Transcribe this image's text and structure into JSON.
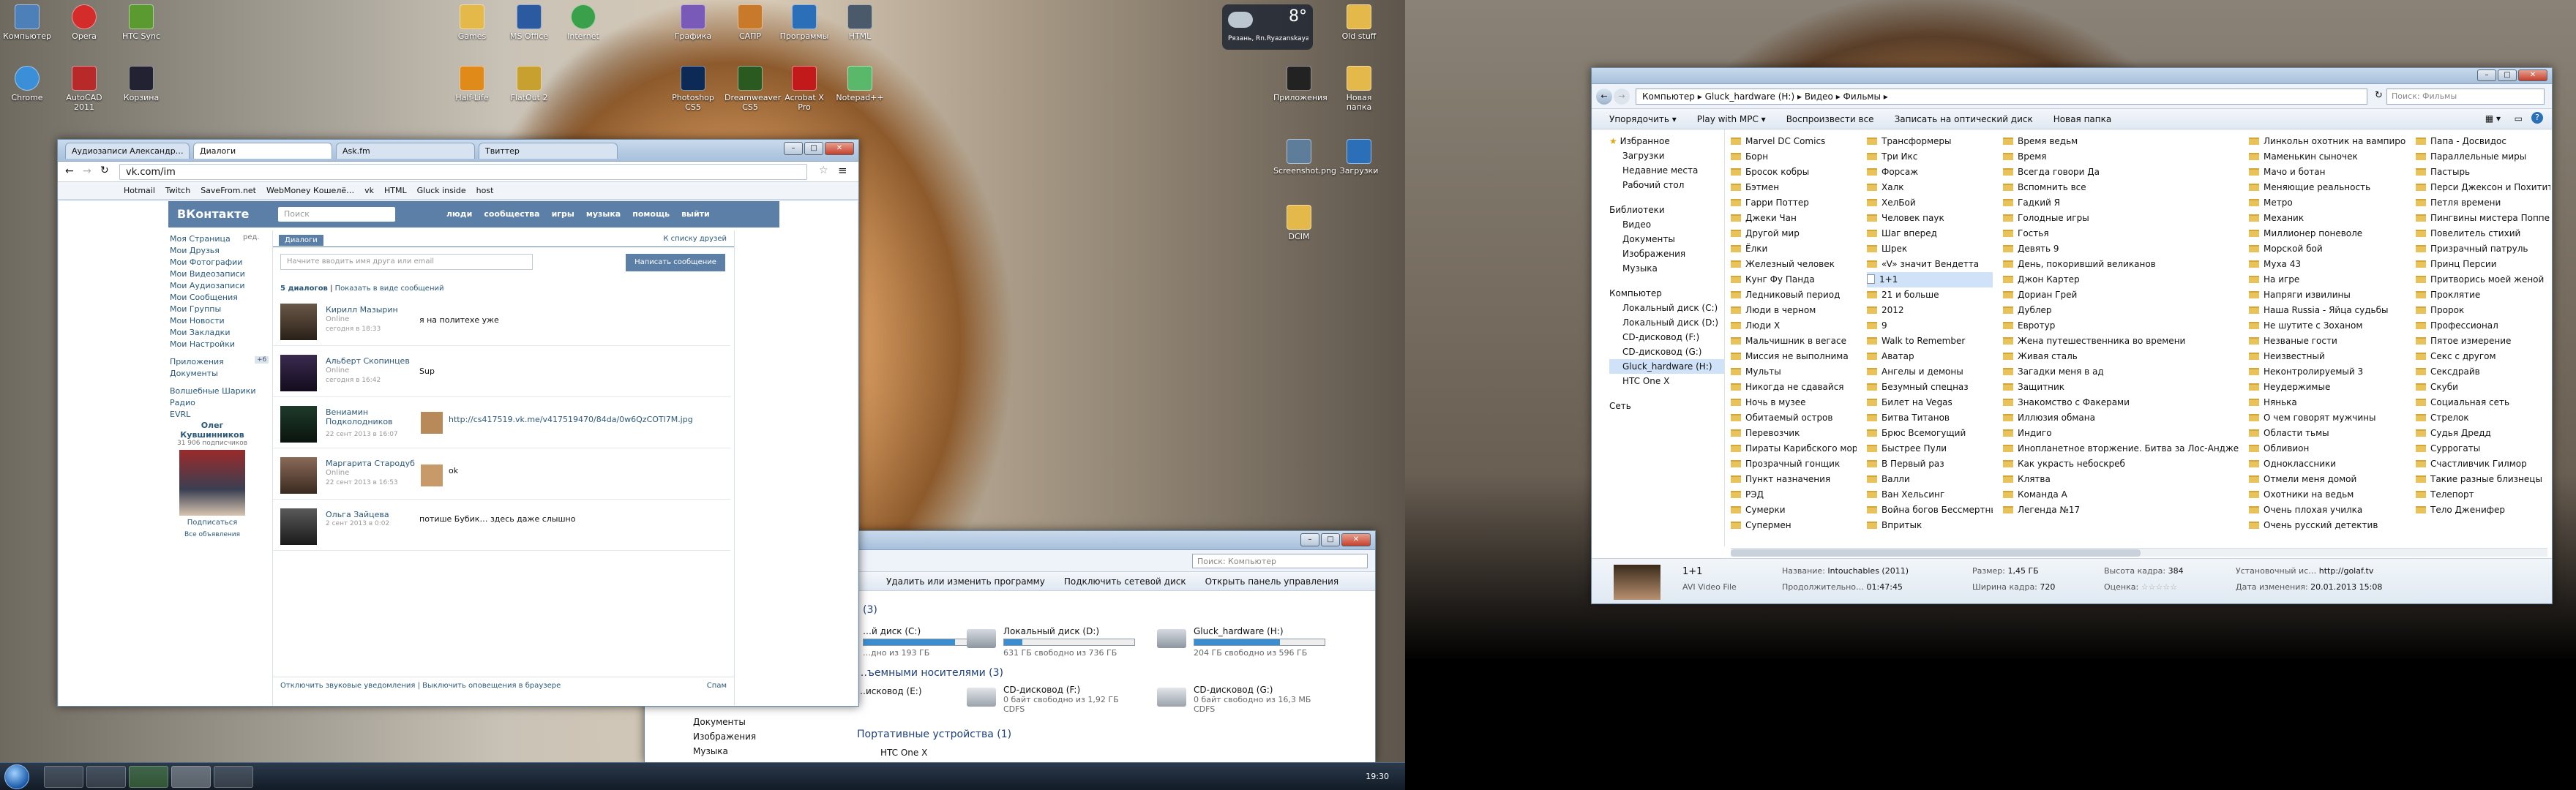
{
  "desktop_icons": {
    "computer": "Компьютер",
    "opera": "Opera",
    "htcsync": "HTC Sync",
    "games": "Games",
    "msoffice": "MS Office",
    "internet": "Internet",
    "grafika": "Графика",
    "sapr": "САПР",
    "programs": "Программы",
    "html": "HTML",
    "chrome": "Chrome",
    "recycle": "Корзина",
    "acad": "AutoCAD 2011",
    "half": "Half-Life",
    "flatout": "FlatOut 2",
    "ps": "Photoshop CS5",
    "dreamweaver": "Dreamweaver CS5",
    "acrobat": "Acrobat X Pro",
    "notepad": "Notepad++",
    "clock_city": "Рязань, Rn.Ryazanskaya",
    "temp": "8°",
    "screenshot": "Screenshot.png",
    "downloads": "Загрузки",
    "oldstuff": "Old stuff",
    "apps": "Приложения",
    "dcim": "DCIM",
    "folder2": "Новая папка"
  },
  "browser": {
    "tabs": [
      "Аудиозаписи Александр…",
      "Диалоги",
      "Ask.fm",
      "Твиттер"
    ],
    "url": "vk.com/im",
    "bookmarks": [
      "Hotmail",
      "Twitch",
      "SaveFrom.net",
      "WebMoney Кошелё…",
      "vk",
      "HTML",
      "Gluck inside",
      "host"
    ],
    "vk": {
      "logo": "ВКонтакте",
      "search_placeholder": "Поиск",
      "nav": [
        "люди",
        "сообщества",
        "игры",
        "музыка",
        "помощь",
        "выйти"
      ],
      "left_menu": [
        "Моя Страница",
        "Мои Друзья",
        "Мои Фотографии",
        "Мои Видеозаписи",
        "Мои Аудиозаписи",
        "Мои Сообщения",
        "Мои Группы",
        "Мои Новости",
        "Мои Закладки",
        "Мои Настройки",
        "Приложения",
        "Документы",
        "Волшебные Шарики",
        "Радио",
        "EVRL"
      ],
      "edit": "ред.",
      "apps_count": "+6",
      "promo_name": "Олег Кувшинников",
      "promo_sub": "31 906 подписчиков",
      "subscribe": "Подписаться",
      "all": "Все объявления",
      "dialogs_tab": "Диалоги",
      "to_list": "К списку друзей",
      "input_placeholder": "Начните вводить имя друга или email",
      "write_btn": "Написать сообщение",
      "dialogs_count": "5 диалогов",
      "show_as": "Показать в виде сообщений",
      "dialogs": [
        {
          "name": "Кирилл Мазырин",
          "status": "Online",
          "time": "сегодня в 18:33",
          "text": "я на политехе уже"
        },
        {
          "name": "Альберт Скопинцев",
          "status": "Online",
          "time": "сегодня в 16:42",
          "text": "Sup"
        },
        {
          "name": "Вениамин Подколодников",
          "status": "",
          "time": "22 сент 2013 в 16:07",
          "text": "http://cs417519.vk.me/v417519470/84da/0w6QzCOTl7M.jpg"
        },
        {
          "name": "Маргарита Стародуб",
          "status": "Online",
          "time": "22 сент 2013 в 16:53",
          "text": "ok"
        },
        {
          "name": "Ольга Зайцева",
          "status": "",
          "time": "2 сент 2013 в 0:02",
          "text": "потише Бубик… здесь даже слышно"
        }
      ],
      "footer_left": "Отключить звуковые уведомления",
      "footer_mid": "Выключить оповещения в браузере",
      "footer_right": "Спам"
    }
  },
  "computer_window": {
    "search": "Поиск: Компьютер",
    "cmds": [
      "Удалить или изменить программу",
      "Подключить сетевой диск",
      "Открыть панель управления"
    ],
    "section_removable": "…ъемными носителями (3)",
    "count3": "(3)",
    "drives": [
      {
        "name": "…й диск (C:)",
        "free": "…дно из 193 ГБ",
        "fill": 0.7
      },
      {
        "name": "Локальный диск (D:)",
        "free": "631 ГБ свободно из 736 ГБ",
        "fill": 0.14
      },
      {
        "name": "Gluck_hardware (H:)",
        "free": "204 ГБ свободно из 596 ГБ",
        "fill": 0.66
      }
    ],
    "removable": [
      {
        "name": "…исковод (E:)",
        "free": ""
      },
      {
        "name": "CD-дисковод (F:)",
        "free": "0 байт свободно из 1,92 ГБ",
        "fs": "CDFS"
      },
      {
        "name": "CD-дисковод (G:)",
        "free": "0 байт свободно из 16,3 МБ",
        "fs": "CDFS"
      }
    ],
    "portable": "Портативные устройства (1)",
    "htc": "HTC One X",
    "nav": [
      "Документы",
      "Изображения",
      "Музыка"
    ]
  },
  "taskbar": {
    "time": "19:30"
  },
  "explorer": {
    "breadcrumb": [
      "Компьютер",
      "Gluck_hardware (H:)",
      "Видео",
      "Фильмы"
    ],
    "search": "Поиск: Фильмы",
    "commands": [
      "Упорядочить ▾",
      "Play with MPC ▾",
      "Воспроизвести все",
      "Записать на оптический диск",
      "Новая папка"
    ],
    "nav": {
      "favorites": "Избранное",
      "fav_items": [
        "Загрузки",
        "Недавние места",
        "Рабочий стол"
      ],
      "libraries": "Библиотеки",
      "lib_items": [
        "Видео",
        "Документы",
        "Изображения",
        "Музыка"
      ],
      "computer": "Компьютер",
      "comp_items": [
        "Локальный диск (C:)",
        "Локальный диск (D:)",
        "CD-дисковод (F:)",
        "CD-дисковод (G:)",
        "Gluck_hardware (H:)",
        "HTC One X"
      ],
      "network": "Сеть"
    },
    "columns": [
      [
        "Marvel DC Comics",
        "Борн",
        "Бросок кобры",
        "Бэтмен",
        "Гарри Поттер",
        "Джеки Чан",
        "Другой мир",
        "Ёлки",
        "Железный человек",
        "Кунг Фу Панда",
        "Ледниковый период",
        "Люди в черном",
        "Люди Х",
        "Мальчишник в вегасе",
        "Миссия не выполнима",
        "Мульты",
        "Никогда не сдавайся",
        "Ночь в музее",
        "Обитаемый остров",
        "Перевозчик",
        "Пираты Карибского моря",
        "Прозрачный гонщик",
        "Пункт назначения",
        "РЭД",
        "Сумерки",
        "Супермен"
      ],
      [
        "Трансформеры",
        "Три Икс",
        "Форсаж",
        "Халк",
        "ХелБой",
        "Человек паук",
        "Шаг вперед",
        "Шрек",
        "«V» значит Вендетта",
        "1+1",
        "21 и больше",
        "2012",
        "9",
        "Walk to Remember",
        "Аватар",
        "Ангелы и демоны",
        "Безумный спецназ",
        "Билет на Vegas",
        "Битва Титанов",
        "Брюс Всемогущий",
        "Быстрее Пули",
        "В Первый раз",
        "Валли",
        "Ван Хельсинг",
        "Война богов Бессмертные",
        "Впритык"
      ],
      [
        "Время ведьм",
        "Время",
        "Всегда говори Да",
        "Вспомнить все",
        "Гадкий Я",
        "Голодные игры",
        "Гостья",
        "Девять 9",
        "День, покоривший великанов",
        "Джон Картер",
        "Дориан Грей",
        "Дублер",
        "Евротур",
        "Жена путешественника во времени",
        "Живая сталь",
        "Загадки меня в ад",
        "Защитник",
        "Знакомство с Факерами",
        "Иллюзия обмана",
        "Индиго",
        "Инопланетное вторжение. Битва за Лос-Анджелес",
        "Как украсть небоскреб",
        "Клятва",
        "Команда А",
        "Легенда №17"
      ],
      [
        "Линкольн охотник на вампиров",
        "Маменькин сыночек",
        "Мачо и ботан",
        "Меняющие реальность",
        "Метро",
        "Механик",
        "Миллионер поневоле",
        "Морской бой",
        "Муха 43",
        "На игре",
        "Напряги извилины",
        "Наша Russia - Яйца судьбы",
        "Не шутите с Зоханом",
        "Незваные гости",
        "Неизвестный",
        "Неконтролируемый 3",
        "Неудержимые",
        "Нянька",
        "О чем говорят мужчины",
        "Области тьмы",
        "Обливион",
        "Одноклассники",
        "Отмели меня домой",
        "Охотники на ведьм",
        "Очень плохая училка",
        "Очень русский детектив"
      ],
      [
        "Папа - Досвидос",
        "Параллельные миры",
        "Пастырь",
        "Перси Джексон и Похититель молний",
        "Петля времени",
        "Пингвины мистера Поппера",
        "Повелитель стихий",
        "Призрачный патруль",
        "Принц Персии",
        "Притворись моей женой",
        "Проклятие",
        "Пророк",
        "Профессионал",
        "Пятое измерение",
        "Секс с другом",
        "Сексдрайв",
        "Скуби",
        "Социальная сеть",
        "Стрелок",
        "Судья Дредд",
        "Суррогаты",
        "Счастливчик Гилмор",
        "Такие разные близнецы",
        "Телепорт",
        "Тело Дженифер"
      ]
    ],
    "details": {
      "name": "1+1",
      "type": "AVI Video File",
      "title_k": "Название:",
      "title_v": "Intouchables (2011)",
      "dur_k": "Продолжительно…",
      "dur_v": "01:47:45",
      "size_k": "Размер:",
      "size_v": "1,45 ГБ",
      "w_k": "Ширина кадра:",
      "w_v": "720",
      "h_k": "Высота кадра:",
      "h_v": "384",
      "rate_k": "Оценка:",
      "created_k": "Установочный ис…",
      "created_v": "http://golaf.tv",
      "date_k": "Дата изменения:",
      "date_v": "20.01.2013 15:08"
    }
  }
}
